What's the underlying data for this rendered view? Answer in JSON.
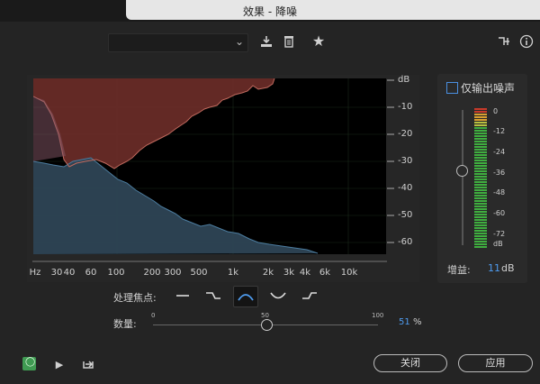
{
  "window": {
    "title": "效果 - 降噪"
  },
  "toolbar": {
    "preset_value": "",
    "preset_chevron_icon": "chevron-down-icon",
    "save_icon": "download-icon",
    "delete_icon": "trash-icon",
    "favorite_icon": "star-icon",
    "routing_icon": "channel-routing-icon",
    "info_icon": "info-icon"
  },
  "graph": {
    "y_ticks": [
      "dB",
      "-10",
      "-20",
      "-30",
      "-40",
      "-50",
      "-60"
    ],
    "x_ticks": [
      "Hz",
      "30",
      "40",
      "60",
      "100",
      "200",
      "300",
      "500",
      "1k",
      "2k",
      "3k",
      "4k",
      "6k",
      "10k"
    ],
    "colors": {
      "noise_fill": "#6b2c28",
      "signal_fill": "#2e4455",
      "background": "#000000"
    }
  },
  "side_panel": {
    "checkbox_label": "仅输出噪声",
    "meter_labels": [
      "0",
      "-12",
      "-24",
      "-36",
      "-48",
      "-60",
      "-72",
      "dB"
    ],
    "gain_label": "增益:",
    "gain_value": "11",
    "gain_unit": "dB"
  },
  "focus": {
    "label": "处理焦点:",
    "options": [
      "flat-icon",
      "low-shelf-icon",
      "mid-bell-icon",
      "mid-notch-icon",
      "high-shelf-icon"
    ],
    "selected_index": 2,
    "accent": "#4f9cf0"
  },
  "amount": {
    "label": "数量:",
    "min": "0",
    "mid": "50",
    "max": "100",
    "value": "51",
    "unit": "%"
  },
  "bottom": {
    "power_icon": "power-icon",
    "play_icon": "play-icon",
    "loop_icon": "export-icon",
    "close_label": "关闭",
    "apply_label": "应用"
  }
}
